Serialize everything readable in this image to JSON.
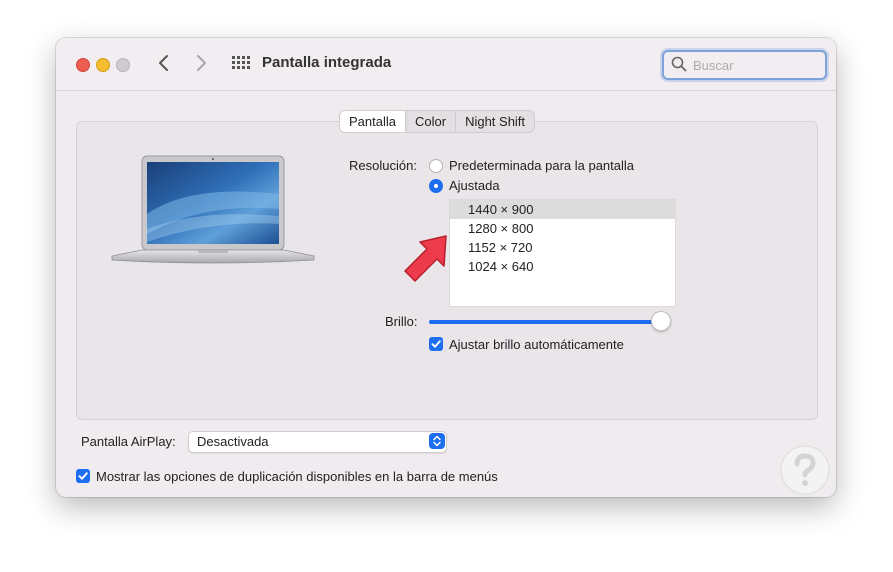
{
  "window": {
    "title": "Pantalla integrada",
    "search_placeholder": "Buscar"
  },
  "tabs": [
    "Pantalla",
    "Color",
    "Night Shift"
  ],
  "active_tab": "Pantalla",
  "resolution": {
    "label": "Resolución:",
    "options": [
      "Predeterminada para la pantalla",
      "Ajustada"
    ],
    "selected_option": "Ajustada",
    "list": [
      "1440 × 900",
      "1280 × 800",
      "1152 × 720",
      "1024 × 640"
    ],
    "selected_resolution": "1440 × 900"
  },
  "brightness": {
    "label": "Brillo:",
    "level": 1.0,
    "auto_label": "Ajustar brillo automáticamente",
    "auto_checked": true
  },
  "airplay": {
    "label": "Pantalla AirPlay:",
    "value": "Desactivada"
  },
  "mirroring": {
    "label": "Mostrar las opciones de duplicación disponibles en la barra de menús",
    "checked": true
  },
  "colors": {
    "accent": "#1d6ef0",
    "annotation_arrow": "#ee3b4c",
    "window_bg": "#efebef"
  },
  "icons": [
    "back-arrow-icon",
    "forward-arrow-icon",
    "grid-icon",
    "search-icon",
    "macbook-air-image",
    "red-annotation-arrow",
    "watermark-logo"
  ]
}
